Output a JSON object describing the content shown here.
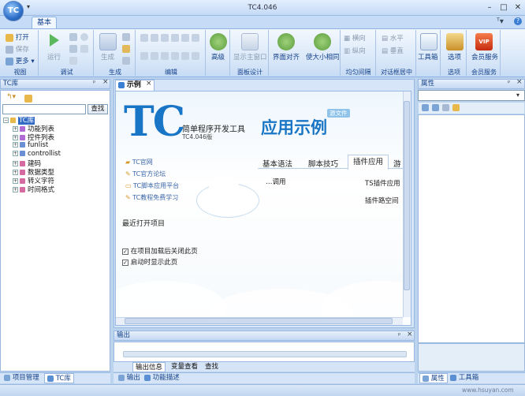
{
  "titlebar": {
    "app_icon_text": "TC",
    "title": "TC4.046",
    "min": "–",
    "max": "□",
    "close": "✕",
    "qa_arrow": "▾"
  },
  "ribbon": {
    "tab": "基本",
    "view": {
      "open": "打开",
      "save": "保存",
      "more": "更多",
      "label": "视图"
    },
    "debug": {
      "run": "运行",
      "label": "调试"
    },
    "generate": {
      "generate": "生成",
      "label": "生成"
    },
    "edit": {
      "label": "编辑"
    },
    "advanced": {
      "advanced": "高级"
    },
    "panel": {
      "show_main": "显示主窗口",
      "label": "面板设计"
    },
    "align": {
      "align": "界面对齐",
      "same_size": "使大小相同",
      "equal_h": "横向",
      "equal_v": "纵向",
      "label": "均匀间隔"
    },
    "center": {
      "h": "水平",
      "v": "垂直",
      "label": "对话框居中"
    },
    "toolbox": {
      "label": "工具箱"
    },
    "options": {
      "label": "选项",
      "group": "选项"
    },
    "vip": {
      "badge": "VIP",
      "label": "会员服务",
      "group": "会员服务"
    }
  },
  "left_panel": {
    "title": "TC库",
    "pin": "ᵖ",
    "close": "×",
    "find_button": "查找",
    "search_value": "",
    "tree": [
      {
        "label": "TC库",
        "selected": true,
        "level": 0,
        "expander": "−"
      },
      {
        "label": "功能列表",
        "level": 1,
        "expander": "+"
      },
      {
        "label": "控件列表",
        "level": 1,
        "expander": "+"
      },
      {
        "label": "funlist",
        "level": 1,
        "expander": "+"
      },
      {
        "label": "controllist",
        "level": 1,
        "expander": "+"
      },
      {
        "label": "建码",
        "level": 1,
        "expander": "+"
      },
      {
        "label": "数据类型",
        "level": 1,
        "expander": "+"
      },
      {
        "label": "转义字符",
        "level": 1,
        "expander": "+"
      },
      {
        "label": "时间格式",
        "level": 1,
        "expander": "+"
      }
    ],
    "bottom_tabs": [
      "项目管理",
      "TC库"
    ]
  },
  "doc_tab": {
    "label": "示例",
    "close": "×"
  },
  "sample": {
    "logo": "TC",
    "subtitle": "简单程序开发工具",
    "version": "TC4.046版",
    "heading": "应用示例",
    "badge": "源文件",
    "links": [
      "TC官网",
      "TC官方论坛",
      "TC脚本应用平台",
      "TC教程免费学习"
    ],
    "recent": "最近打开项目",
    "tabs": [
      "基本语法",
      "脚本技巧",
      "插件应用",
      "游"
    ],
    "right_items": [
      "TS插件应用",
      "插件路空间"
    ],
    "left_fragment": "…调用",
    "options": [
      "在项目加载后关闭此页",
      "启动时显示此页"
    ]
  },
  "output": {
    "title": "输出",
    "tabs": [
      "输出信息",
      "变量查看",
      "查找"
    ]
  },
  "status_tabs": [
    "输出",
    "功能描述"
  ],
  "right_panel": {
    "title": "属性",
    "bottom_tabs": [
      "属性",
      "工具箱"
    ]
  },
  "watermark": "www.hsuyan.com"
}
